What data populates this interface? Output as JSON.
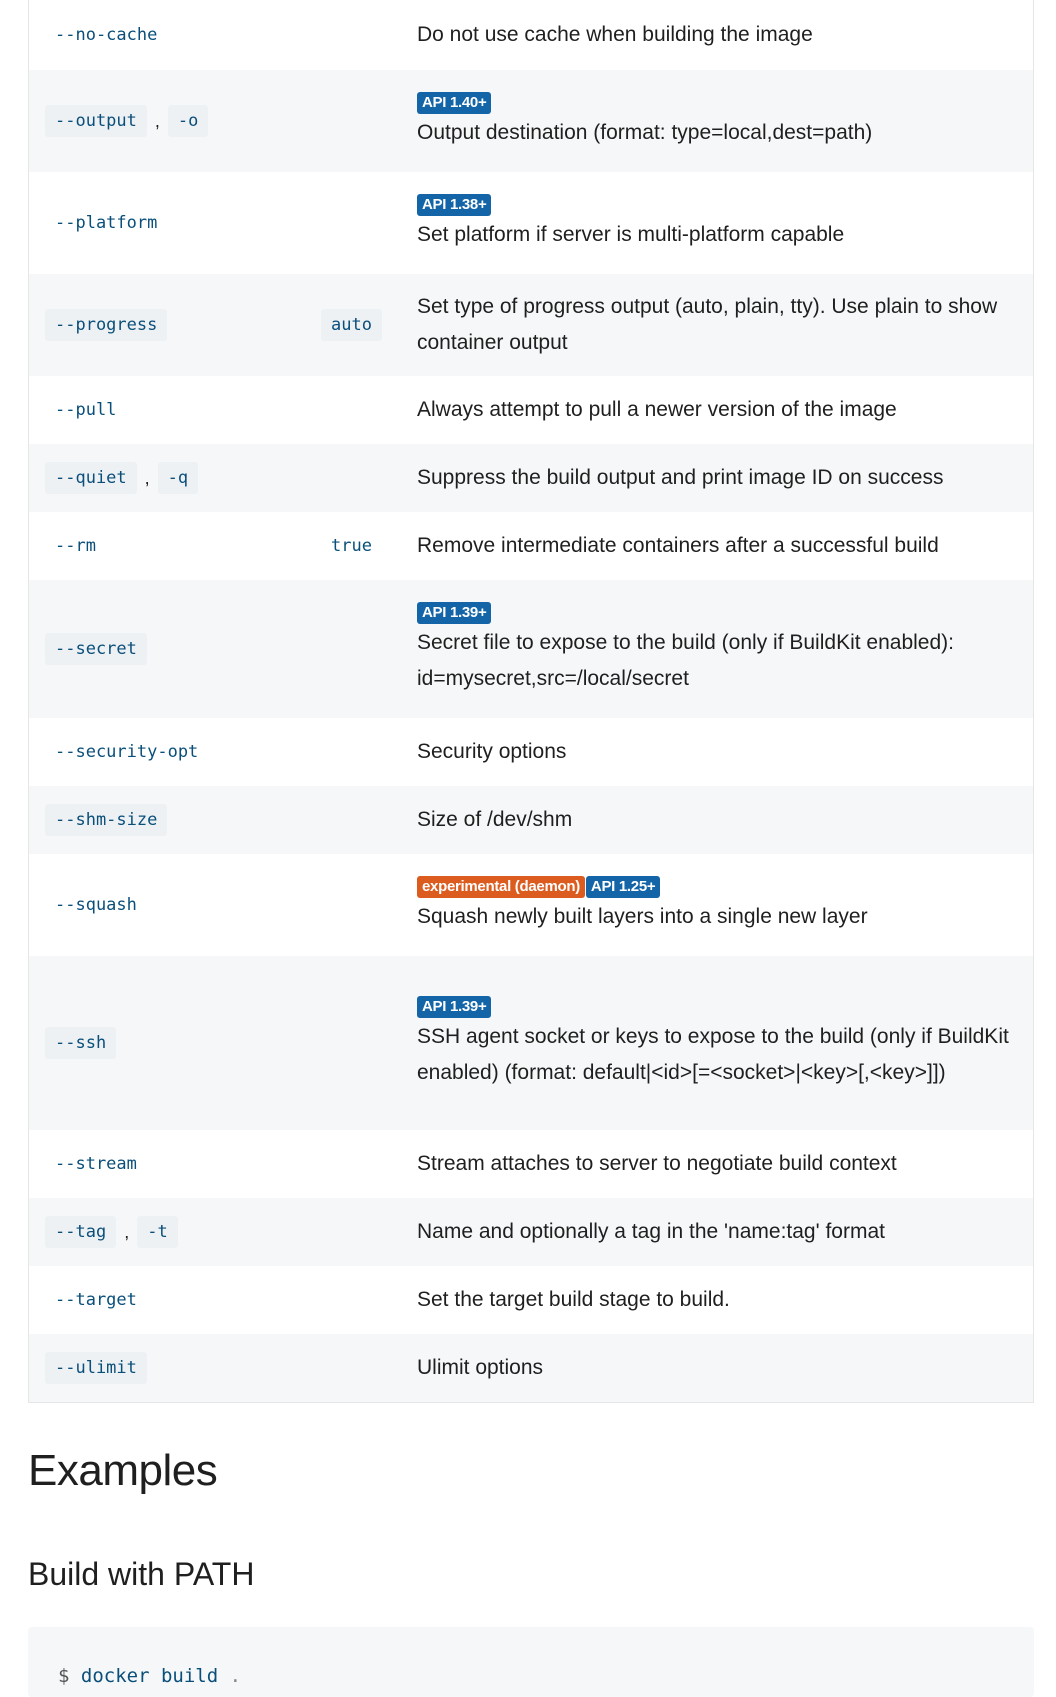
{
  "options": [
    {
      "flags": [
        "--no-cache"
      ],
      "default": "",
      "badges": [],
      "description": "Do not use cache when building the image",
      "height": 70,
      "plain": true
    },
    {
      "flags": [
        "--output",
        "-o"
      ],
      "default": "",
      "badges": [
        {
          "kind": "api",
          "text": "API 1.40+"
        }
      ],
      "description": "Output destination (format: type=local,dest=path)",
      "height": 102
    },
    {
      "flags": [
        "--platform"
      ],
      "default": "",
      "badges": [
        {
          "kind": "api",
          "text": "API 1.38+"
        }
      ],
      "description": "Set platform if server is multi-platform capable",
      "height": 102,
      "plain": true
    },
    {
      "flags": [
        "--progress"
      ],
      "default": "auto",
      "badges": [],
      "description": "Set type of progress output (auto, plain, tty). Use plain to show container output",
      "height": 102
    },
    {
      "flags": [
        "--pull"
      ],
      "default": "",
      "badges": [],
      "description": "Always attempt to pull a newer version of the image",
      "height": 68,
      "plain": true
    },
    {
      "flags": [
        "--quiet",
        "-q"
      ],
      "default": "",
      "badges": [],
      "description": "Suppress the build output and print image ID on success",
      "height": 68
    },
    {
      "flags": [
        "--rm"
      ],
      "default": "true",
      "badges": [],
      "description": "Remove intermediate containers after a successful build",
      "height": 68,
      "plain": true
    },
    {
      "flags": [
        "--secret"
      ],
      "default": "",
      "badges": [
        {
          "kind": "api",
          "text": "API 1.39+"
        }
      ],
      "description": "Secret file to expose to the build (only if BuildKit enabled): id=mysecret,src=/local/secret",
      "height": 138
    },
    {
      "flags": [
        "--security-opt"
      ],
      "default": "",
      "badges": [],
      "description": "Security options",
      "height": 68,
      "plain": true
    },
    {
      "flags": [
        "--shm-size"
      ],
      "default": "",
      "badges": [],
      "description": "Size of /dev/shm",
      "height": 68
    },
    {
      "flags": [
        "--squash"
      ],
      "default": "",
      "badges": [
        {
          "kind": "exp",
          "text": "experimental (daemon)"
        },
        {
          "kind": "api",
          "text": "API 1.25+"
        }
      ],
      "description": "Squash newly built layers into a single new layer",
      "height": 102,
      "plain": true
    },
    {
      "flags": [
        "--ssh"
      ],
      "default": "",
      "badges": [
        {
          "kind": "api",
          "text": "API 1.39+"
        }
      ],
      "description": "SSH agent socket or keys to expose to the build (only if BuildKit enabled) (format: default|<id>[=<socket>|<key>[,<key>]])",
      "height": 174
    },
    {
      "flags": [
        "--stream"
      ],
      "default": "",
      "badges": [],
      "description": "Stream attaches to server to negotiate build context",
      "height": 68,
      "plain": true
    },
    {
      "flags": [
        "--tag",
        "-t"
      ],
      "default": "",
      "badges": [],
      "description": "Name and optionally a tag in the 'name:tag' format",
      "height": 68
    },
    {
      "flags": [
        "--target"
      ],
      "default": "",
      "badges": [],
      "description": "Set the target build stage to build.",
      "height": 68,
      "plain": true
    },
    {
      "flags": [
        "--ulimit"
      ],
      "default": "",
      "badges": [],
      "description": "Ulimit options",
      "height": 68
    }
  ],
  "headings": {
    "examples": "Examples",
    "build_with_path": "Build with PATH"
  },
  "code_example": {
    "prompt": "$",
    "command": "docker build",
    "argument": "."
  }
}
